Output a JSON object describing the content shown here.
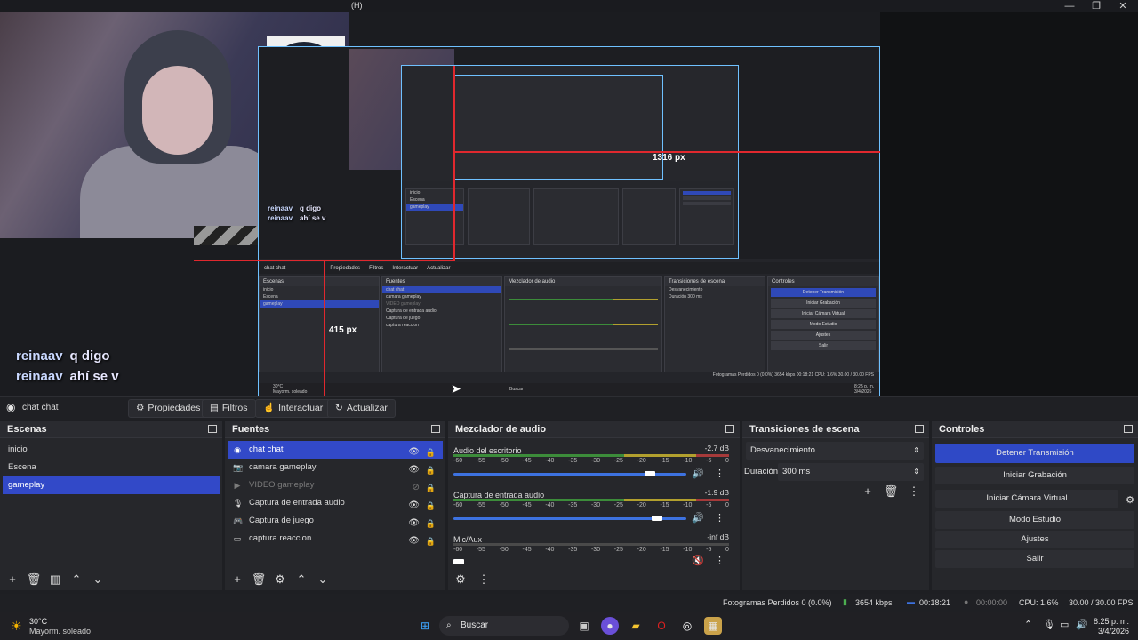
{
  "window": {
    "title_fragment": "(H)",
    "controls": {
      "minimize": "—",
      "restore": "❐",
      "close": "✕"
    }
  },
  "preview": {
    "chat": [
      {
        "user": "reinaav",
        "msg": "q digo"
      },
      {
        "user": "reinaav",
        "msg": "ahí se v"
      }
    ],
    "nested_chat": [
      {
        "user": "reinaav",
        "msg": "q digo"
      },
      {
        "user": "reinaav",
        "msg": "ahí se v"
      }
    ],
    "measure_labels": {
      "width_px": "1316 px",
      "height_px": "415 px"
    },
    "nested_ui": {
      "source_name": "chat chat",
      "toolbar": [
        "Propiedades",
        "Filtros",
        "Interactuar",
        "Actualizar"
      ],
      "scenes_title": "Escenas",
      "scenes": [
        "inicio",
        "Escena",
        "gameplay"
      ],
      "sources_title": "Fuentes",
      "sources": [
        "chat chat",
        "camara gameplay",
        "VIDEO gameplay",
        "Captura de entrada audio",
        "Captura de juego",
        "captura reaccion"
      ],
      "mixer_title": "Mezclador de audio",
      "transitions_title": "Transiciones de escena",
      "transition": "Desvanecimiento",
      "duration_label": "Duración",
      "duration": "300 ms",
      "controls_title": "Controles",
      "controls": [
        "Detener Transmisión",
        "Iniciar Grabación",
        "Iniciar Cámara Virtual",
        "Modo Estudio",
        "Ajustes",
        "Salir"
      ],
      "status": "Fotogramas Perdidos 0 (0.0%)  3654 kbps  00:18:21  CPU: 1.6%  30.00 / 30.00 FPS",
      "taskbar_search": "Buscar",
      "weather": "30°C",
      "weather_desc": "Mayorm. soleado",
      "clock": "8:25 p. m.",
      "date": "3/4/2026"
    }
  },
  "toolbar": {
    "source_icon": "gear-icon",
    "source_name": "chat chat",
    "properties": "Propiedades",
    "filters": "Filtros",
    "interact": "Interactuar",
    "refresh": "Actualizar"
  },
  "scenes": {
    "title": "Escenas",
    "items": [
      "inicio",
      "Escena",
      "gameplay"
    ],
    "selected": 2
  },
  "sources": {
    "title": "Fuentes",
    "items": [
      {
        "name": "chat chat",
        "icon": "browser-icon",
        "hidden": false
      },
      {
        "name": "camara gameplay",
        "icon": "camera-icon",
        "hidden": false
      },
      {
        "name": "VIDEO gameplay",
        "icon": "play-icon",
        "hidden": true
      },
      {
        "name": "Captura de entrada audio",
        "icon": "microphone-icon",
        "hidden": false
      },
      {
        "name": "Captura de juego",
        "icon": "gamepad-icon",
        "hidden": false
      },
      {
        "name": "captura reaccion",
        "icon": "monitor-icon",
        "hidden": false
      }
    ]
  },
  "mixer": {
    "title": "Mezclador de audio",
    "ticks": [
      "-60",
      "-55",
      "-50",
      "-45",
      "-40",
      "-35",
      "-30",
      "-25",
      "-20",
      "-15",
      "-10",
      "-5",
      "0"
    ],
    "tracks": [
      {
        "name": "Audio del escritorio",
        "db": "-2.7 dB",
        "volume": 0.86
      },
      {
        "name": "Captura de entrada audio",
        "db": "-1.9 dB",
        "volume": 0.89
      },
      {
        "name": "Mic/Aux",
        "db": "-inf dB",
        "volume": 0.0,
        "muted": true
      }
    ]
  },
  "transitions": {
    "title": "Transiciones de escena",
    "type": "Desvanecimiento",
    "duration_label": "Duración",
    "duration": "300 ms"
  },
  "controls": {
    "title": "Controles",
    "stop_stream": "Detener Transmisión",
    "start_recording": "Iniciar Grabación",
    "start_virtualcam": "Iniciar Cámara Virtual",
    "studio_mode": "Modo Estudio",
    "settings": "Ajustes",
    "exit": "Salir"
  },
  "status": {
    "dropped_frames": "Fotogramas Perdidos 0 (0.0%)",
    "bitrate": "3654 kbps",
    "stream_time": "00:18:21",
    "rec_time": "00:00:00",
    "cpu": "CPU: 1.6%",
    "fps": "30.00 / 30.00 FPS"
  },
  "taskbar": {
    "weather_temp": "30°C",
    "weather_desc": "Mayorm. soleado",
    "search_placeholder": "Buscar",
    "time": "8:25 p. m.",
    "date": "3/4/2026"
  },
  "colors": {
    "accent": "#3249c8",
    "panel": "#26272b",
    "live": "#4caf50",
    "meter_green": "#3c8c3a",
    "meter_yellow": "#b2a02e",
    "meter_red": "#a63a3a"
  }
}
